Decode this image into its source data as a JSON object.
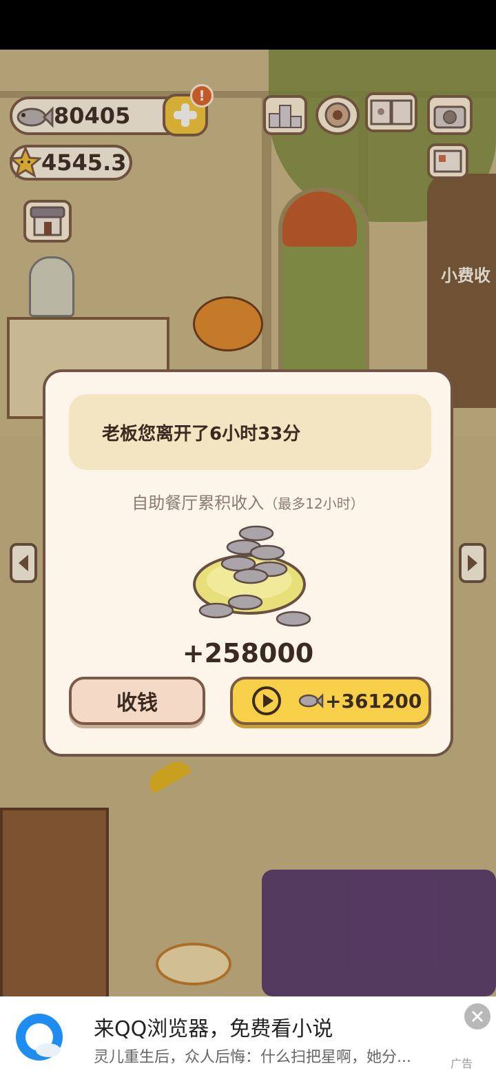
{
  "hud": {
    "fish_count": "80405",
    "star_count": "4545.3",
    "alert_badge": "!"
  },
  "scene": {
    "tip_label": "小费收"
  },
  "dialog": {
    "message": "老板您离开了6小时33分",
    "subtitle_main": "自助餐厅累积收入",
    "subtitle_note": "（最多12小时）",
    "amount": "+258000",
    "collect_label": "收钱",
    "video_reward": "+361200"
  },
  "ad": {
    "title": "来QQ浏览器，免费看小说",
    "description": "灵儿重生后，众人后悔：什么扫把星啊，她分...",
    "tag": "广告"
  },
  "colors": {
    "accent": "#f7cf48",
    "dialog_bg": "#fdf5ea",
    "border": "#6f5446"
  }
}
